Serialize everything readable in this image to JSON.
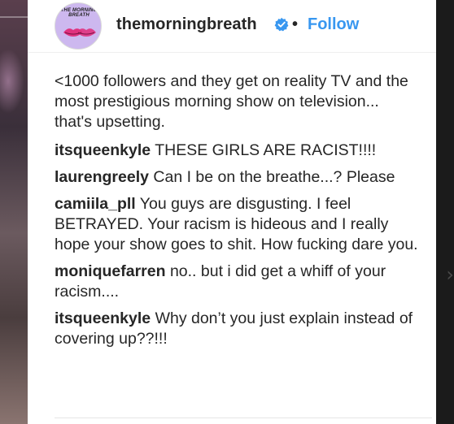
{
  "post": {
    "username": "themorningbreath",
    "follow_label": "Follow",
    "separator": "•",
    "avatar_text": "THE MORNING BREATH"
  },
  "caption": "<1000 followers and they get on reality TV and the most prestigious morning show on television... that's upsetting.",
  "comments": [
    {
      "user": "itsqueenkyle",
      "text": "THESE GIRLS ARE RACIST!!!!"
    },
    {
      "user": "laurengreely",
      "text": "Can I be on the breathe...? Please"
    },
    {
      "user": "camiila_pll",
      "text": "You guys are disgusting. I feel BETRAYED. Your racism is hideous and I really hope your show goes to shit. How fucking dare you."
    },
    {
      "user": "moniquefarren",
      "text": "no.. but i did get a whiff of your racism...."
    },
    {
      "user": "itsqueenkyle",
      "text": "Why don’t you just explain instead of covering up??!!!"
    }
  ],
  "colors": {
    "follow": "#3897f0",
    "verified": "#3897f0",
    "avatar_bg": "#cdb8ef",
    "text": "#262626"
  },
  "icons": {
    "verified": "verified-badge-icon",
    "next": "chevron-right-icon"
  }
}
